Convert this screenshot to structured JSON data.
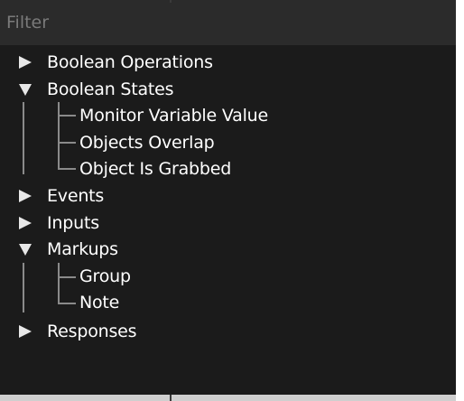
{
  "filter": {
    "placeholder": "Filter"
  },
  "tree": {
    "categories": [
      {
        "label": "Boolean Operations",
        "expanded": false
      },
      {
        "label": "Boolean States",
        "expanded": true,
        "children": [
          "Monitor Variable Value",
          "Objects Overlap",
          "Object Is Grabbed"
        ]
      },
      {
        "label": "Events",
        "expanded": false
      },
      {
        "label": "Inputs",
        "expanded": false
      },
      {
        "label": "Markups",
        "expanded": true,
        "children": [
          "Group",
          "Note"
        ]
      },
      {
        "label": "Responses",
        "expanded": false
      }
    ]
  },
  "colors": {
    "panel_background": "#1b1b1b",
    "filter_background": "#2b2b2b",
    "placeholder_text": "#7a7a7a",
    "item_text": "#ffffff",
    "tree_lines": "#8a8a8a"
  },
  "icons": {
    "collapsed": "triangle-right-icon",
    "expanded": "triangle-down-icon"
  }
}
